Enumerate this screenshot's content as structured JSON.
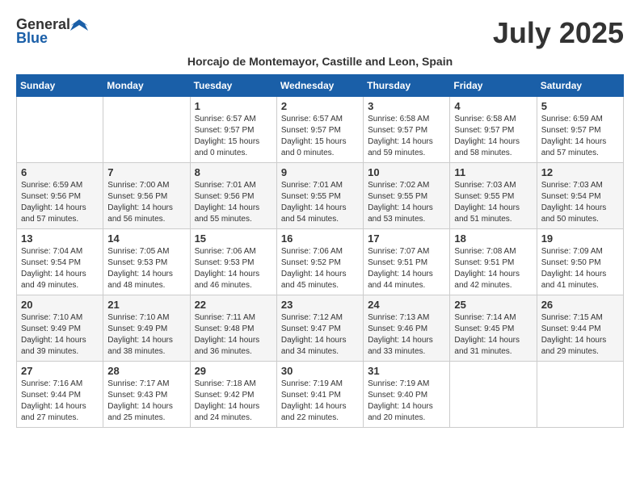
{
  "header": {
    "logo_general": "General",
    "logo_blue": "Blue",
    "month_title": "July 2025",
    "subtitle": "Horcajo de Montemayor, Castille and Leon, Spain"
  },
  "days_of_week": [
    "Sunday",
    "Monday",
    "Tuesday",
    "Wednesday",
    "Thursday",
    "Friday",
    "Saturday"
  ],
  "weeks": [
    [
      {
        "day": "",
        "sunrise": "",
        "sunset": "",
        "daylight": ""
      },
      {
        "day": "",
        "sunrise": "",
        "sunset": "",
        "daylight": ""
      },
      {
        "day": "1",
        "sunrise": "Sunrise: 6:57 AM",
        "sunset": "Sunset: 9:57 PM",
        "daylight": "Daylight: 15 hours and 0 minutes."
      },
      {
        "day": "2",
        "sunrise": "Sunrise: 6:57 AM",
        "sunset": "Sunset: 9:57 PM",
        "daylight": "Daylight: 15 hours and 0 minutes."
      },
      {
        "day": "3",
        "sunrise": "Sunrise: 6:58 AM",
        "sunset": "Sunset: 9:57 PM",
        "daylight": "Daylight: 14 hours and 59 minutes."
      },
      {
        "day": "4",
        "sunrise": "Sunrise: 6:58 AM",
        "sunset": "Sunset: 9:57 PM",
        "daylight": "Daylight: 14 hours and 58 minutes."
      },
      {
        "day": "5",
        "sunrise": "Sunrise: 6:59 AM",
        "sunset": "Sunset: 9:57 PM",
        "daylight": "Daylight: 14 hours and 57 minutes."
      }
    ],
    [
      {
        "day": "6",
        "sunrise": "Sunrise: 6:59 AM",
        "sunset": "Sunset: 9:56 PM",
        "daylight": "Daylight: 14 hours and 57 minutes."
      },
      {
        "day": "7",
        "sunrise": "Sunrise: 7:00 AM",
        "sunset": "Sunset: 9:56 PM",
        "daylight": "Daylight: 14 hours and 56 minutes."
      },
      {
        "day": "8",
        "sunrise": "Sunrise: 7:01 AM",
        "sunset": "Sunset: 9:56 PM",
        "daylight": "Daylight: 14 hours and 55 minutes."
      },
      {
        "day": "9",
        "sunrise": "Sunrise: 7:01 AM",
        "sunset": "Sunset: 9:55 PM",
        "daylight": "Daylight: 14 hours and 54 minutes."
      },
      {
        "day": "10",
        "sunrise": "Sunrise: 7:02 AM",
        "sunset": "Sunset: 9:55 PM",
        "daylight": "Daylight: 14 hours and 53 minutes."
      },
      {
        "day": "11",
        "sunrise": "Sunrise: 7:03 AM",
        "sunset": "Sunset: 9:55 PM",
        "daylight": "Daylight: 14 hours and 51 minutes."
      },
      {
        "day": "12",
        "sunrise": "Sunrise: 7:03 AM",
        "sunset": "Sunset: 9:54 PM",
        "daylight": "Daylight: 14 hours and 50 minutes."
      }
    ],
    [
      {
        "day": "13",
        "sunrise": "Sunrise: 7:04 AM",
        "sunset": "Sunset: 9:54 PM",
        "daylight": "Daylight: 14 hours and 49 minutes."
      },
      {
        "day": "14",
        "sunrise": "Sunrise: 7:05 AM",
        "sunset": "Sunset: 9:53 PM",
        "daylight": "Daylight: 14 hours and 48 minutes."
      },
      {
        "day": "15",
        "sunrise": "Sunrise: 7:06 AM",
        "sunset": "Sunset: 9:53 PM",
        "daylight": "Daylight: 14 hours and 46 minutes."
      },
      {
        "day": "16",
        "sunrise": "Sunrise: 7:06 AM",
        "sunset": "Sunset: 9:52 PM",
        "daylight": "Daylight: 14 hours and 45 minutes."
      },
      {
        "day": "17",
        "sunrise": "Sunrise: 7:07 AM",
        "sunset": "Sunset: 9:51 PM",
        "daylight": "Daylight: 14 hours and 44 minutes."
      },
      {
        "day": "18",
        "sunrise": "Sunrise: 7:08 AM",
        "sunset": "Sunset: 9:51 PM",
        "daylight": "Daylight: 14 hours and 42 minutes."
      },
      {
        "day": "19",
        "sunrise": "Sunrise: 7:09 AM",
        "sunset": "Sunset: 9:50 PM",
        "daylight": "Daylight: 14 hours and 41 minutes."
      }
    ],
    [
      {
        "day": "20",
        "sunrise": "Sunrise: 7:10 AM",
        "sunset": "Sunset: 9:49 PM",
        "daylight": "Daylight: 14 hours and 39 minutes."
      },
      {
        "day": "21",
        "sunrise": "Sunrise: 7:10 AM",
        "sunset": "Sunset: 9:49 PM",
        "daylight": "Daylight: 14 hours and 38 minutes."
      },
      {
        "day": "22",
        "sunrise": "Sunrise: 7:11 AM",
        "sunset": "Sunset: 9:48 PM",
        "daylight": "Daylight: 14 hours and 36 minutes."
      },
      {
        "day": "23",
        "sunrise": "Sunrise: 7:12 AM",
        "sunset": "Sunset: 9:47 PM",
        "daylight": "Daylight: 14 hours and 34 minutes."
      },
      {
        "day": "24",
        "sunrise": "Sunrise: 7:13 AM",
        "sunset": "Sunset: 9:46 PM",
        "daylight": "Daylight: 14 hours and 33 minutes."
      },
      {
        "day": "25",
        "sunrise": "Sunrise: 7:14 AM",
        "sunset": "Sunset: 9:45 PM",
        "daylight": "Daylight: 14 hours and 31 minutes."
      },
      {
        "day": "26",
        "sunrise": "Sunrise: 7:15 AM",
        "sunset": "Sunset: 9:44 PM",
        "daylight": "Daylight: 14 hours and 29 minutes."
      }
    ],
    [
      {
        "day": "27",
        "sunrise": "Sunrise: 7:16 AM",
        "sunset": "Sunset: 9:44 PM",
        "daylight": "Daylight: 14 hours and 27 minutes."
      },
      {
        "day": "28",
        "sunrise": "Sunrise: 7:17 AM",
        "sunset": "Sunset: 9:43 PM",
        "daylight": "Daylight: 14 hours and 25 minutes."
      },
      {
        "day": "29",
        "sunrise": "Sunrise: 7:18 AM",
        "sunset": "Sunset: 9:42 PM",
        "daylight": "Daylight: 14 hours and 24 minutes."
      },
      {
        "day": "30",
        "sunrise": "Sunrise: 7:19 AM",
        "sunset": "Sunset: 9:41 PM",
        "daylight": "Daylight: 14 hours and 22 minutes."
      },
      {
        "day": "31",
        "sunrise": "Sunrise: 7:19 AM",
        "sunset": "Sunset: 9:40 PM",
        "daylight": "Daylight: 14 hours and 20 minutes."
      },
      {
        "day": "",
        "sunrise": "",
        "sunset": "",
        "daylight": ""
      },
      {
        "day": "",
        "sunrise": "",
        "sunset": "",
        "daylight": ""
      }
    ]
  ]
}
